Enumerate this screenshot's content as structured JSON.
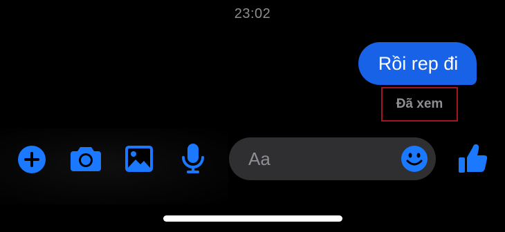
{
  "status": {
    "time": "23:02"
  },
  "conversation": {
    "messages": [
      {
        "text": "Rồi rep đi",
        "sender": "me"
      }
    ],
    "read_receipt": "Đã xem"
  },
  "toolbar": {
    "icons": [
      "plus-icon",
      "camera-icon",
      "image-icon",
      "microphone-icon",
      "emoji-icon",
      "thumbs-up-icon"
    ],
    "composer_placeholder": "Aa"
  },
  "colors": {
    "accent": "#1762e6",
    "icon_blue": "#1a79ff",
    "background": "#000000",
    "composer_bg": "#2f2f31",
    "highlight_border": "#a31621"
  }
}
